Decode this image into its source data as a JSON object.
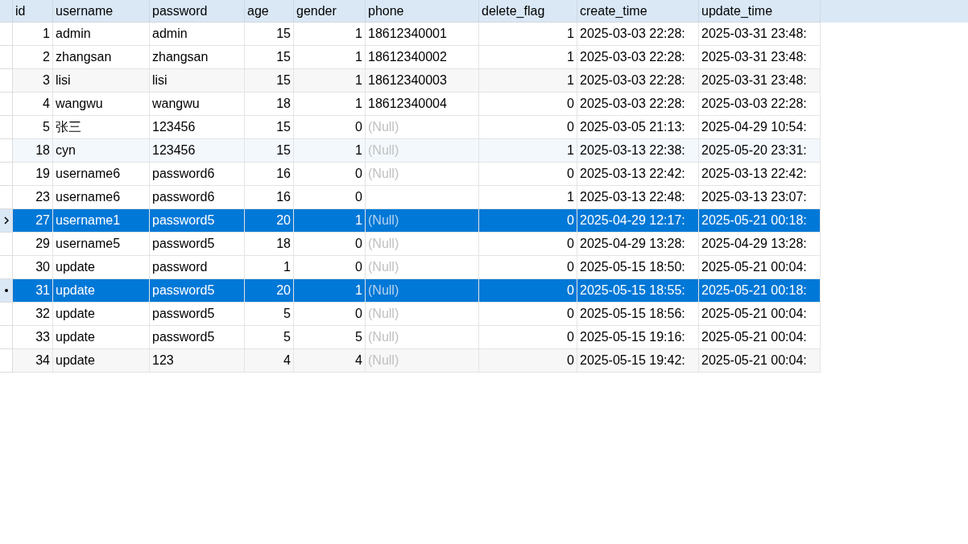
{
  "table": {
    "columns": [
      {
        "label": "id",
        "numeric": true
      },
      {
        "label": "username",
        "numeric": false
      },
      {
        "label": "password",
        "numeric": false
      },
      {
        "label": "age",
        "numeric": true
      },
      {
        "label": "gender",
        "numeric": true
      },
      {
        "label": "phone",
        "numeric": false
      },
      {
        "label": "delete_flag",
        "numeric": true
      },
      {
        "label": "create_time",
        "numeric": false
      },
      {
        "label": "update_time",
        "numeric": false
      }
    ],
    "rows": [
      {
        "selected": false,
        "cells": [
          {
            "text": "1"
          },
          {
            "text": "admin"
          },
          {
            "text": "admin"
          },
          {
            "text": "15"
          },
          {
            "text": "1"
          },
          {
            "text": "18612340001"
          },
          {
            "text": "1"
          },
          {
            "text": "2025-03-03 22:28:"
          },
          {
            "text": "2025-03-31 23:48:"
          }
        ]
      },
      {
        "selected": false,
        "cells": [
          {
            "text": "2"
          },
          {
            "text": "zhangsan"
          },
          {
            "text": "zhangsan"
          },
          {
            "text": "15"
          },
          {
            "text": "1"
          },
          {
            "text": "18612340002"
          },
          {
            "text": "1"
          },
          {
            "text": "2025-03-03 22:28:"
          },
          {
            "text": "2025-03-31 23:48:"
          }
        ]
      },
      {
        "selected": false,
        "tinted": true,
        "cells": [
          {
            "text": "3"
          },
          {
            "text": "lisi"
          },
          {
            "text": "lisi"
          },
          {
            "text": "15"
          },
          {
            "text": "1"
          },
          {
            "text": "18612340003"
          },
          {
            "text": "1"
          },
          {
            "text": "2025-03-03 22:28:"
          },
          {
            "text": "2025-03-31 23:48:"
          }
        ]
      },
      {
        "selected": false,
        "cells": [
          {
            "text": "4"
          },
          {
            "text": "wangwu"
          },
          {
            "text": "wangwu"
          },
          {
            "text": "18"
          },
          {
            "text": "1"
          },
          {
            "text": "18612340004"
          },
          {
            "text": "0"
          },
          {
            "text": "2025-03-03 22:28:"
          },
          {
            "text": "2025-03-03 22:28:"
          }
        ]
      },
      {
        "selected": false,
        "cells": [
          {
            "text": "5"
          },
          {
            "text": "张三"
          },
          {
            "text": "123456"
          },
          {
            "text": "15"
          },
          {
            "text": "0"
          },
          {
            "text": "(Null)",
            "kind": "null"
          },
          {
            "text": "0"
          },
          {
            "text": "2025-03-05 21:13:"
          },
          {
            "text": "2025-04-29 10:54:"
          }
        ]
      },
      {
        "selected": false,
        "hovered": true,
        "cells": [
          {
            "text": "18"
          },
          {
            "text": "cyn"
          },
          {
            "text": "123456"
          },
          {
            "text": "15"
          },
          {
            "text": "1"
          },
          {
            "text": "(Null)",
            "kind": "null"
          },
          {
            "text": "1"
          },
          {
            "text": "2025-03-13 22:38:"
          },
          {
            "text": "2025-05-20 23:31:"
          }
        ]
      },
      {
        "selected": false,
        "cells": [
          {
            "text": "19"
          },
          {
            "text": "username6"
          },
          {
            "text": "password6"
          },
          {
            "text": "16"
          },
          {
            "text": "0"
          },
          {
            "text": "(Null)",
            "kind": "null"
          },
          {
            "text": "0"
          },
          {
            "text": "2025-03-13 22:42:"
          },
          {
            "text": "2025-03-13 22:42:"
          }
        ]
      },
      {
        "selected": false,
        "cells": [
          {
            "text": "23"
          },
          {
            "text": "username6"
          },
          {
            "text": "password6"
          },
          {
            "text": "16"
          },
          {
            "text": "0"
          },
          {},
          {
            "text": "1"
          },
          {
            "text": "2025-03-13 22:48:"
          },
          {
            "text": "2025-03-13 23:07:"
          }
        ]
      },
      {
        "selected": true,
        "current": true,
        "cells": [
          {
            "text": "27"
          },
          {
            "text": "username1"
          },
          {
            "text": "password5"
          },
          {
            "text": "20"
          },
          {
            "text": "1"
          },
          {
            "text": "(Null)",
            "kind": "null"
          },
          {
            "text": "0"
          },
          {
            "text": "2025-04-29 12:17:"
          },
          {
            "text": "2025-05-21 00:18:"
          }
        ]
      },
      {
        "selected": false,
        "cells": [
          {
            "text": "29"
          },
          {
            "text": "username5"
          },
          {
            "text": "password5"
          },
          {
            "text": "18"
          },
          {
            "text": "0"
          },
          {
            "text": "(Null)",
            "kind": "null"
          },
          {
            "text": "0"
          },
          {
            "text": "2025-04-29 13:28:"
          },
          {
            "text": "2025-04-29 13:28:"
          }
        ]
      },
      {
        "selected": false,
        "cells": [
          {
            "text": "30"
          },
          {
            "text": "update"
          },
          {
            "text": "password"
          },
          {
            "text": "1"
          },
          {
            "text": "0"
          },
          {
            "text": "(Null)",
            "kind": "null"
          },
          {
            "text": "0"
          },
          {
            "text": "2025-05-15 18:50:"
          },
          {
            "text": "2025-05-21 00:04:"
          }
        ]
      },
      {
        "selected": true,
        "marked": true,
        "cells": [
          {
            "text": "31"
          },
          {
            "text": "update"
          },
          {
            "text": "password5"
          },
          {
            "text": "20"
          },
          {
            "text": "1"
          },
          {
            "text": "(Null)",
            "kind": "null"
          },
          {
            "text": "0"
          },
          {
            "text": "2025-05-15 18:55:"
          },
          {
            "text": "2025-05-21 00:18:"
          }
        ]
      },
      {
        "selected": false,
        "cells": [
          {
            "text": "32"
          },
          {
            "text": "update"
          },
          {
            "text": "password5"
          },
          {
            "text": "5"
          },
          {
            "text": "0"
          },
          {
            "text": "(Null)",
            "kind": "null"
          },
          {
            "text": "0"
          },
          {
            "text": "2025-05-15 18:56:"
          },
          {
            "text": "2025-05-21 00:04:"
          }
        ]
      },
      {
        "selected": false,
        "cells": [
          {
            "text": "33"
          },
          {
            "text": "update"
          },
          {
            "text": "password5"
          },
          {
            "text": "5"
          },
          {
            "text": "5"
          },
          {
            "text": "(Null)",
            "kind": "null"
          },
          {
            "text": "0"
          },
          {
            "text": "2025-05-15 19:16:"
          },
          {
            "text": "2025-05-21 00:04:"
          }
        ]
      },
      {
        "selected": false,
        "tinted": true,
        "cells": [
          {
            "text": "34"
          },
          {
            "text": "update"
          },
          {
            "text": "123"
          },
          {
            "text": "4"
          },
          {
            "text": "4"
          },
          {
            "text": "(Null)",
            "kind": "null"
          },
          {
            "text": "0"
          },
          {
            "text": "2025-05-15 19:42:"
          },
          {
            "text": "2025-05-21 00:04:"
          }
        ]
      }
    ]
  }
}
